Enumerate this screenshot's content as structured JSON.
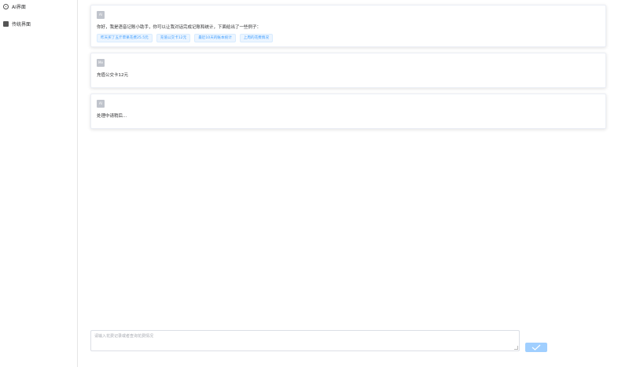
{
  "sidebar": {
    "items": [
      {
        "label": "AI界面",
        "icon": "ai-icon"
      },
      {
        "label": "传统界面",
        "icon": "clipboard-icon"
      }
    ]
  },
  "messages": [
    {
      "avatar": "AI",
      "text": "你好，我是语音记账小助手，你可以让我对话完成记账和统计，下面给出了一些例子：",
      "suggestions": [
        "昨天买了五斤苹果花费25.5元",
        "充值公交卡12元",
        "最近10天的账本统计",
        "上周的花费情况"
      ]
    },
    {
      "avatar": "Me",
      "text": "充值公交卡12元"
    },
    {
      "avatar": "AI",
      "text": "处理中请稍后..."
    }
  ],
  "composer": {
    "placeholder": "请输入花费记录或者查询花费情况",
    "send_icon": "check-icon"
  },
  "colors": {
    "accent": "#409eff",
    "tag_bg": "#ecf5ff",
    "send_button": "#a0cfff"
  }
}
